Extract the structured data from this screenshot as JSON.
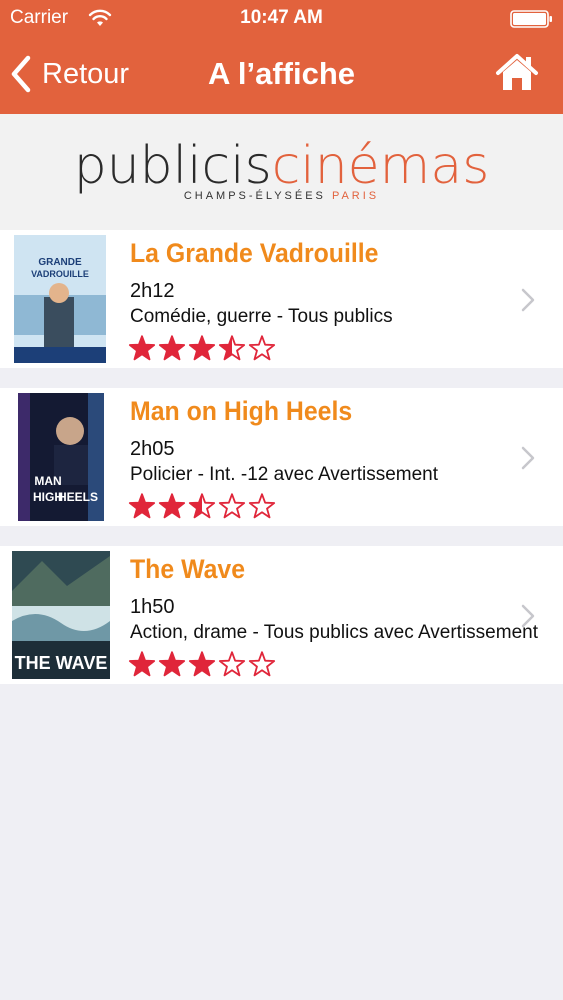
{
  "status_bar": {
    "carrier": "Carrier",
    "time": "10:47 AM"
  },
  "nav": {
    "back_label": "Retour",
    "title": "A l’affiche",
    "home_icon": "home-icon"
  },
  "brand": {
    "name_part1": "publicis",
    "name_part2": "cinémas",
    "subtitle": "CHAMPS-ÉLYSÉES",
    "subtitle_city": "PARIS"
  },
  "colors": {
    "accent": "#e2623d",
    "title_orange": "#f08a1c",
    "star_red": "#e0263a"
  },
  "movies": [
    {
      "title": "La Grande Vadrouille",
      "duration": "2h12",
      "genre": "Comédie, guerre - Tous publics",
      "rating": 3.5,
      "rating_max": 5,
      "poster_title": "GRANDE VADROUILLE"
    },
    {
      "title": "Man on High Heels",
      "duration": "2h05",
      "genre": "Policier - Int. -12 avec Avertissement",
      "rating": 2.5,
      "rating_max": 5,
      "poster_title": "MAN ON HIGH HEELS"
    },
    {
      "title": "The Wave",
      "duration": "1h50",
      "genre": "Action, drame - Tous publics avec Avertissement",
      "rating": 3,
      "rating_max": 5,
      "poster_title": "THE WAVE"
    }
  ]
}
